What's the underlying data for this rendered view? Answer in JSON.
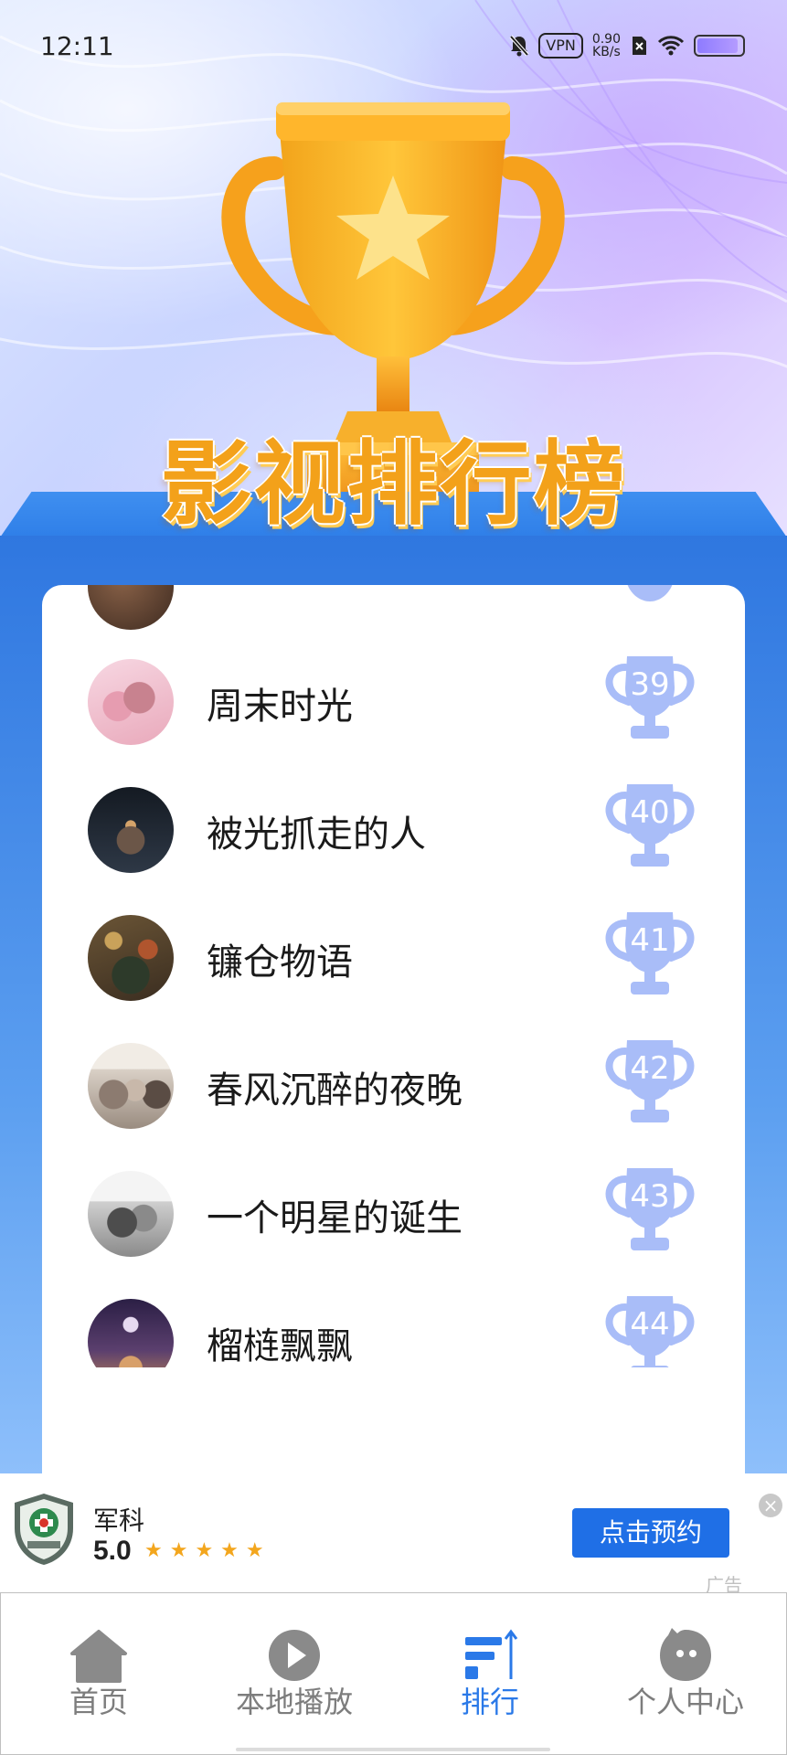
{
  "status_bar": {
    "time": "12:11",
    "vpn": "VPN",
    "speed_value": "0.90",
    "speed_unit": "KB/s",
    "icons": [
      "bell-off-icon",
      "vpn-icon",
      "data-speed",
      "sim-off-icon",
      "wifi-icon",
      "battery-icon"
    ]
  },
  "hero": {
    "title": "影视排行榜",
    "trophy_icon": "trophy-star-icon"
  },
  "ranking": {
    "items": [
      {
        "title": "",
        "rank": "",
        "avatar_colors": [
          "#6b4a34",
          "#3d2a20"
        ]
      },
      {
        "title": "周末时光",
        "rank": "39",
        "avatar_colors": [
          "#f3c7d6",
          "#c8828f"
        ]
      },
      {
        "title": "被光抓走的人",
        "rank": "40",
        "avatar_colors": [
          "#1c2430",
          "#3b4656"
        ]
      },
      {
        "title": "镰仓物语",
        "rank": "41",
        "avatar_colors": [
          "#4a3d2b",
          "#8c6b3f"
        ]
      },
      {
        "title": "春风沉醉的夜晚",
        "rank": "42",
        "avatar_colors": [
          "#e9e4dc",
          "#7a6c62"
        ]
      },
      {
        "title": "一个明星的诞生",
        "rank": "43",
        "avatar_colors": [
          "#f0f0f0",
          "#7c7c7c"
        ]
      },
      {
        "title": "榴梿飘飘",
        "rank": "44",
        "avatar_colors": [
          "#3a2c55",
          "#c98a5a"
        ]
      }
    ],
    "rank_badge_color": "#a9bdf8"
  },
  "ad": {
    "name": "军科",
    "score": "5.0",
    "stars": "★★★★★",
    "button_label": "点击预约",
    "close_label": "×",
    "tag": "广告"
  },
  "tabbar": {
    "tabs": [
      {
        "label": "首页",
        "icon": "home-icon",
        "active": false
      },
      {
        "label": "本地播放",
        "icon": "play-icon",
        "active": false
      },
      {
        "label": "排行",
        "icon": "ranking-icon",
        "active": true
      },
      {
        "label": "个人中心",
        "icon": "profile-icon",
        "active": false
      }
    ]
  },
  "colors": {
    "accent": "#2a79e8",
    "platform": "#2f77e0",
    "trophy_gold": "#f8a51c"
  }
}
